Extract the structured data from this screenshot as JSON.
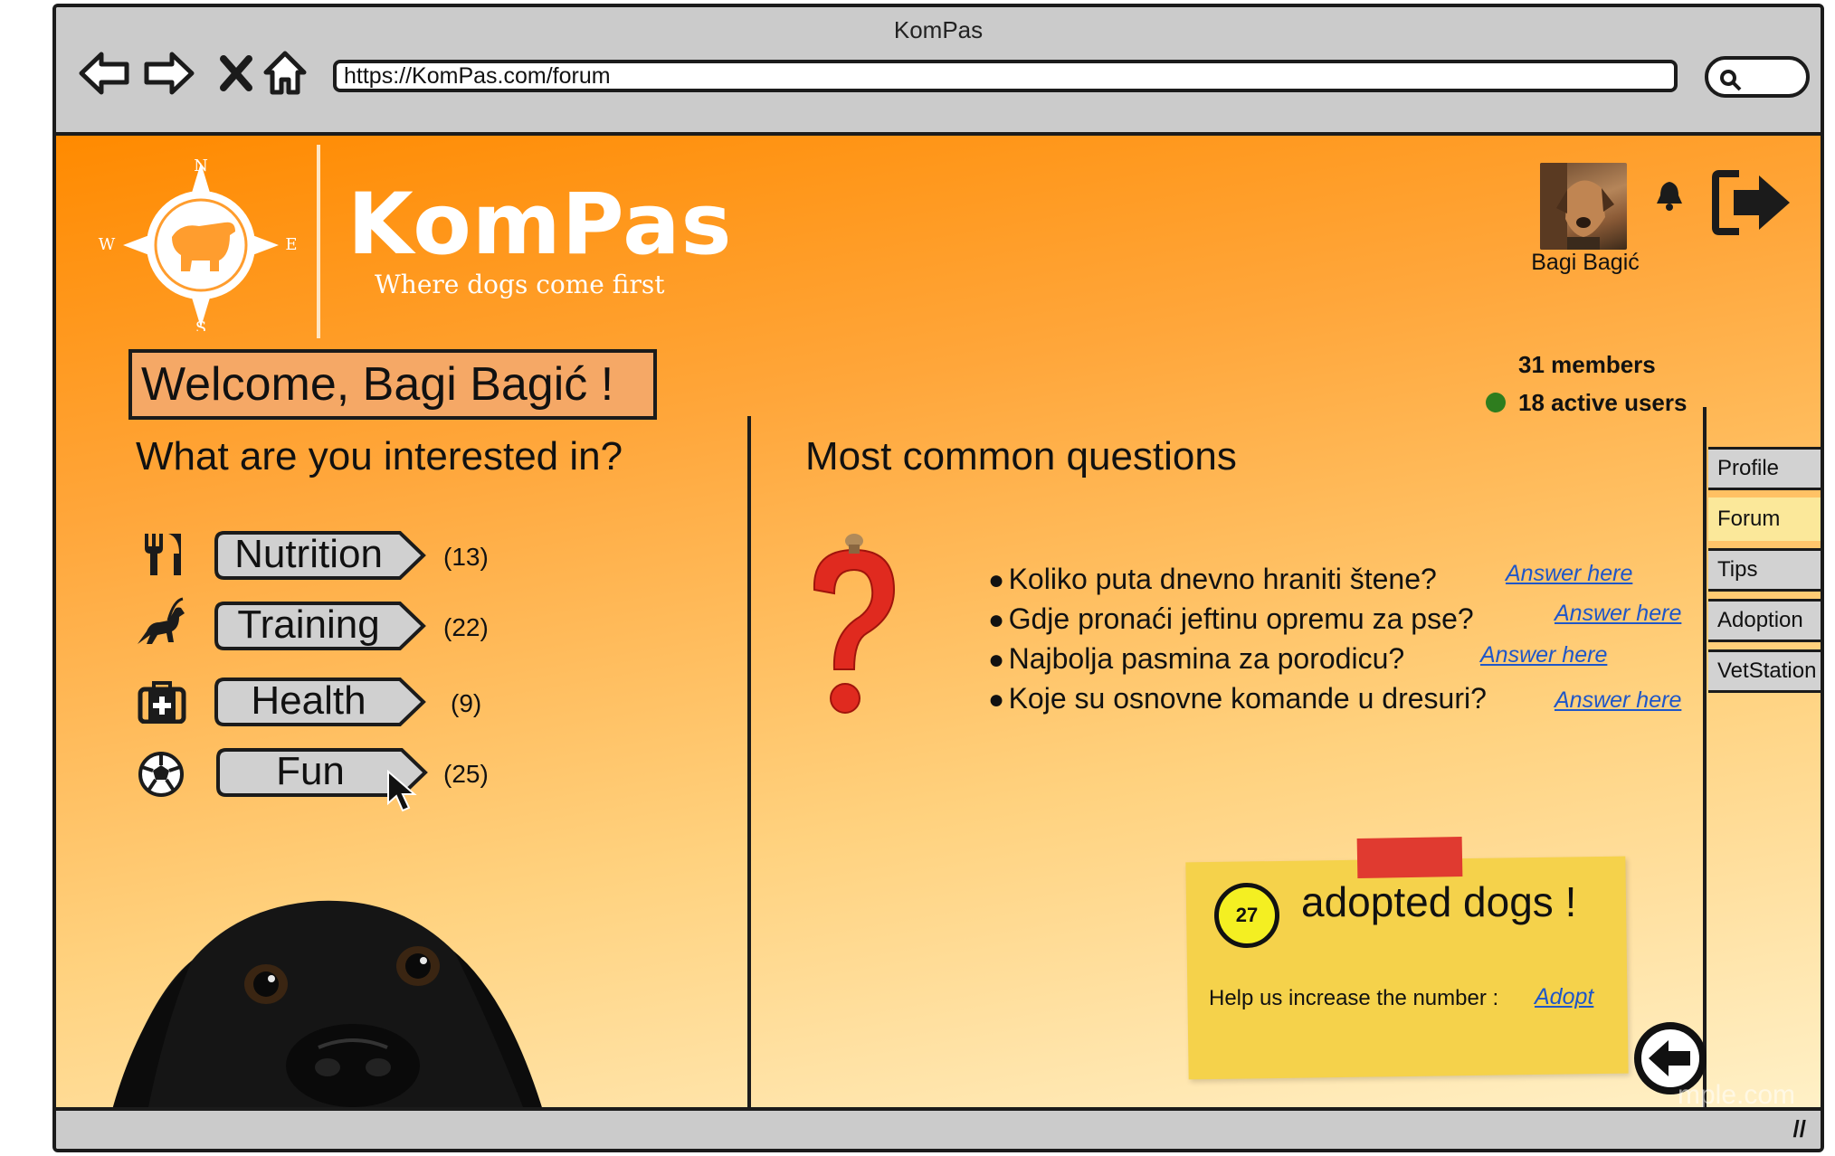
{
  "window": {
    "title": "KomPas",
    "url": "https://KomPas.com/forum"
  },
  "brand": {
    "name": "KomPas",
    "tagline": "Where dogs come first",
    "compass_letters": {
      "n": "N",
      "e": "E",
      "s": "S",
      "w": "W"
    }
  },
  "user": {
    "name": "Bagi Bagić"
  },
  "stats": {
    "members": "31 members",
    "active": "18 active users"
  },
  "welcome": "Welcome, Bagi Bagić !",
  "interests": {
    "heading": "What are you interested in?",
    "categories": [
      {
        "label": "Nutrition",
        "count": "(13)",
        "icon": "fork-knife-icon"
      },
      {
        "label": "Training",
        "count": "(22)",
        "icon": "running-dog-icon"
      },
      {
        "label": "Health",
        "count": "(9)",
        "icon": "first-aid-kit-icon"
      },
      {
        "label": "Fun",
        "count": "(25)",
        "icon": "soccer-ball-icon"
      }
    ]
  },
  "faq": {
    "heading": "Most common questions",
    "questions": [
      {
        "text": "Koliko puta dnevno hraniti štene?",
        "link": "Answer here"
      },
      {
        "text": "Gdje pronaći jeftinu opremu za pse?",
        "link": "Answer here"
      },
      {
        "text": "Najbolja pasmina za porodicu?",
        "link": "Answer here"
      },
      {
        "text": "Koje su osnovne komande u dresuri?",
        "link": "Answer here"
      }
    ]
  },
  "side_tabs": [
    "Profile",
    "Forum",
    "Tips",
    "Adoption",
    "VetStation"
  ],
  "active_tab": "Forum",
  "adoption": {
    "count": "27",
    "label": "adopted dogs !",
    "help": "Help us increase the number :",
    "link": "Adopt"
  },
  "watermark": "mple.com",
  "colors": {
    "accent": "#ff8a00",
    "sticky": "#f5d24b",
    "link": "#1f56c8",
    "active_tab": "#fbe89a"
  }
}
